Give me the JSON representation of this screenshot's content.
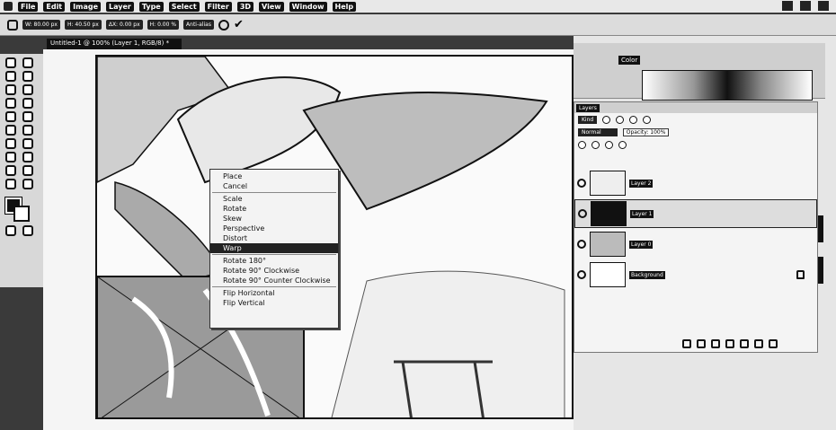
{
  "menubar": {
    "items": [
      "File",
      "Edit",
      "Image",
      "Layer",
      "Type",
      "Select",
      "Filter",
      "3D",
      "View",
      "Window",
      "Help"
    ]
  },
  "options_bar": {
    "fields": [
      "W: 80.00 px",
      "H: 40.50 px",
      "ΔX: 0.00 px",
      "H: 0.00 %",
      "Anti-alias"
    ]
  },
  "document": {
    "tab_label": "Untitled-1 @ 100% (Layer 1, RGB/8) *"
  },
  "context_menu": {
    "groups": [
      [
        "Place",
        "Cancel"
      ],
      [
        "Scale",
        "Rotate",
        "Skew",
        "Perspective",
        "Distort"
      ],
      [
        "Warp"
      ],
      [
        "Rotate 180°",
        "Rotate 90° Clockwise",
        "Rotate 90° Counter Clockwise"
      ],
      [
        "Flip Horizontal",
        "Flip Vertical"
      ]
    ]
  },
  "panels": {
    "color_tab": "Color",
    "layers_tab": "Layers",
    "kind_label": "Kind",
    "blend_mode": "Normal",
    "opacity_label": "Opacity: 100%",
    "layers": [
      {
        "name": "Layer 2"
      },
      {
        "name": "Layer 1"
      },
      {
        "name": "Layer 0"
      },
      {
        "name": "Background"
      }
    ]
  },
  "colors": {
    "foreground": "#111111",
    "background": "#ffffff",
    "selection": "#222222"
  },
  "icons": {
    "confirm": "check-icon",
    "cancel": "cancel-icon",
    "visibility": "eye-icon",
    "lock": "lock-icon"
  }
}
